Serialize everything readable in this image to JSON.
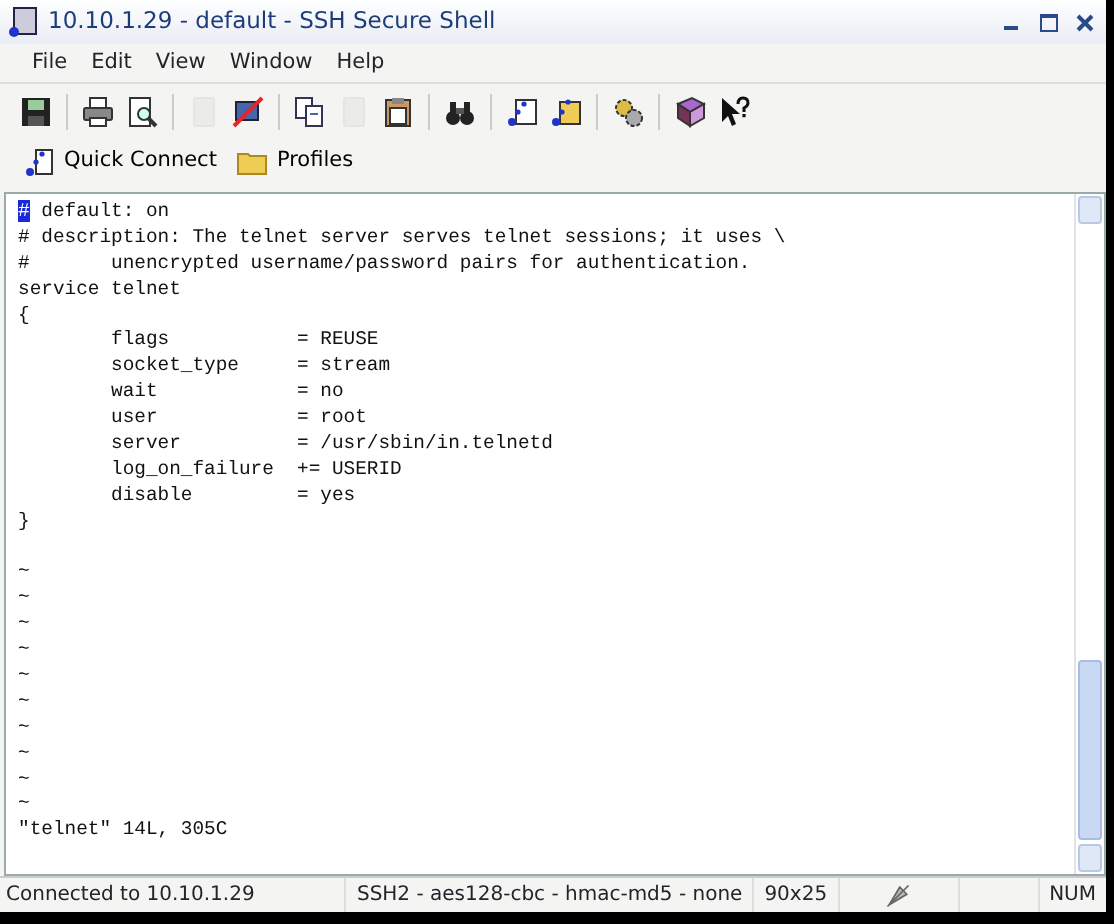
{
  "window": {
    "title": "10.10.1.29 - default - SSH Secure Shell"
  },
  "menu": [
    "File",
    "Edit",
    "View",
    "Window",
    "Help"
  ],
  "toolbar": [
    {
      "kind": "save",
      "disabled": false
    },
    {
      "kind": "sep"
    },
    {
      "kind": "print",
      "disabled": false
    },
    {
      "kind": "preview",
      "disabled": false
    },
    {
      "kind": "sep"
    },
    {
      "kind": "doc",
      "disabled": true
    },
    {
      "kind": "disconnect",
      "disabled": false
    },
    {
      "kind": "sep"
    },
    {
      "kind": "copy",
      "disabled": false
    },
    {
      "kind": "doc",
      "disabled": true
    },
    {
      "kind": "paste",
      "disabled": false
    },
    {
      "kind": "sep"
    },
    {
      "kind": "find",
      "disabled": false
    },
    {
      "kind": "sep"
    },
    {
      "kind": "terminal",
      "disabled": false
    },
    {
      "kind": "transfer",
      "disabled": false
    },
    {
      "kind": "sep"
    },
    {
      "kind": "settings",
      "disabled": false
    },
    {
      "kind": "sep"
    },
    {
      "kind": "help",
      "disabled": false
    },
    {
      "kind": "whatsthis",
      "disabled": false
    }
  ],
  "quickbar": [
    {
      "kind": "connect",
      "label": "Quick Connect"
    },
    {
      "kind": "folder",
      "label": "Profiles"
    }
  ],
  "terminal": {
    "lines": [
      {
        "text": "# default: on",
        "cursor": true
      },
      {
        "text": "# description: The telnet server serves telnet sessions; it uses \\",
        "cursor": false
      },
      {
        "text": "#       unencrypted username/password pairs for authentication.",
        "cursor": false
      },
      {
        "text": "service telnet",
        "cursor": false
      },
      {
        "text": "{",
        "cursor": false
      },
      {
        "text": "        flags           = REUSE",
        "cursor": false
      },
      {
        "text": "        socket_type     = stream",
        "cursor": false
      },
      {
        "text": "        wait            = no",
        "cursor": false
      },
      {
        "text": "        user            = root",
        "cursor": false
      },
      {
        "text": "        server          = /usr/sbin/in.telnetd",
        "cursor": false
      },
      {
        "text": "        log_on_failure  += USERID",
        "cursor": false
      },
      {
        "text": "        disable         = yes",
        "cursor": false
      },
      {
        "text": "}",
        "cursor": false
      },
      {
        "cursor": false
      },
      {
        "text": "~",
        "cursor": false
      },
      {
        "text": "~",
        "cursor": false
      },
      {
        "text": "~",
        "cursor": false
      },
      {
        "text": "~",
        "cursor": false
      },
      {
        "text": "~",
        "cursor": false
      },
      {
        "text": "~",
        "cursor": false
      },
      {
        "text": "~",
        "cursor": false
      },
      {
        "text": "~",
        "cursor": false
      },
      {
        "text": "~",
        "cursor": false
      },
      {
        "text": "~",
        "cursor": false
      },
      {
        "text": "\"telnet\" 14L, 305C",
        "cursor": false
      }
    ]
  },
  "status_bar": {
    "connection": "Connected to 10.10.1.29",
    "cipher": "SSH2 - aes128-cbc - hmac-md5 - none",
    "size": "90x25",
    "keys": "NUM"
  }
}
